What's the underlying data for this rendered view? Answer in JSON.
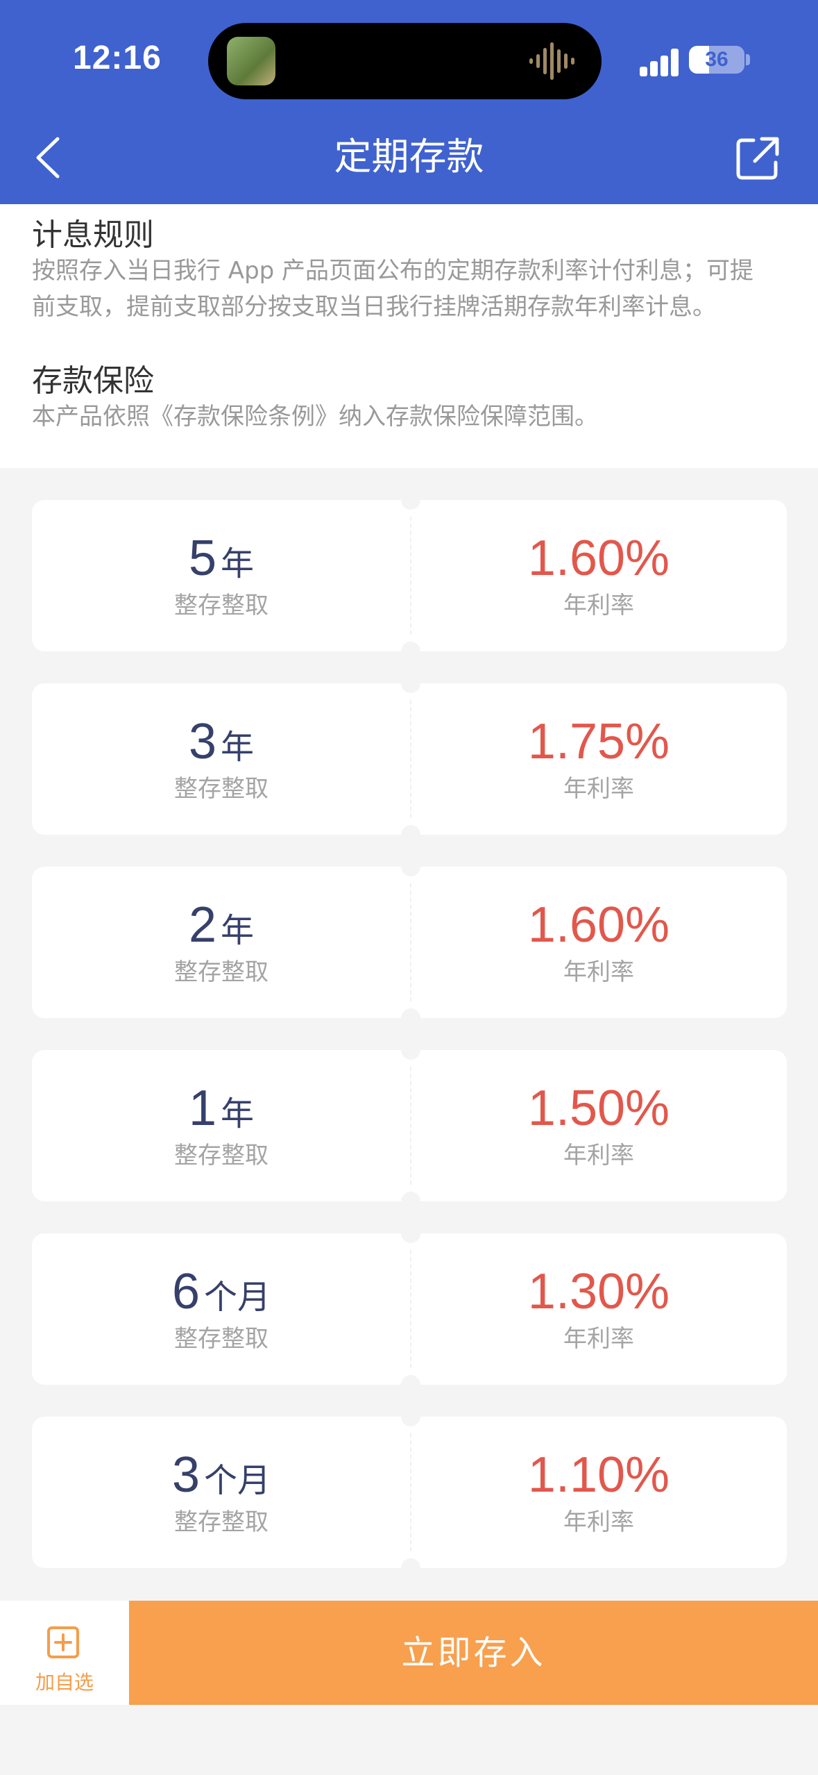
{
  "status_bar": {
    "time": "12:16",
    "battery": "36",
    "battery_level": 0.36
  },
  "header": {
    "title": "定期存款"
  },
  "info": {
    "interest_rules_title": "计息规则",
    "interest_rules_line1": "按照存入当日我行 App 产品页面公布的定期存款利率计付利息；可提",
    "interest_rules_line2": "前支取，提前支取部分按支取当日我行挂牌活期存款年利率计息。",
    "insurance_title": "存款保险",
    "insurance_text": "本产品依照《存款保险条例》纳入存款保险保障范围。"
  },
  "rates": [
    {
      "term": "5",
      "unit": "年",
      "type": "整存整取",
      "rate": "1.60%",
      "rate_label": "年利率"
    },
    {
      "term": "3",
      "unit": "年",
      "type": "整存整取",
      "rate": "1.75%",
      "rate_label": "年利率"
    },
    {
      "term": "2",
      "unit": "年",
      "type": "整存整取",
      "rate": "1.60%",
      "rate_label": "年利率"
    },
    {
      "term": "1",
      "unit": "年",
      "type": "整存整取",
      "rate": "1.50%",
      "rate_label": "年利率"
    },
    {
      "term": "6",
      "unit": "个月",
      "type": "整存整取",
      "rate": "1.30%",
      "rate_label": "年利率"
    },
    {
      "term": "3",
      "unit": "个月",
      "type": "整存整取",
      "rate": "1.10%",
      "rate_label": "年利率"
    }
  ],
  "bottom_bar": {
    "fav_label": "加自选",
    "deposit_label": "立即存入"
  },
  "colors": {
    "header_blue": "#3f62cf",
    "rate_red": "#e2574c",
    "accent_orange": "#f8a04e"
  }
}
